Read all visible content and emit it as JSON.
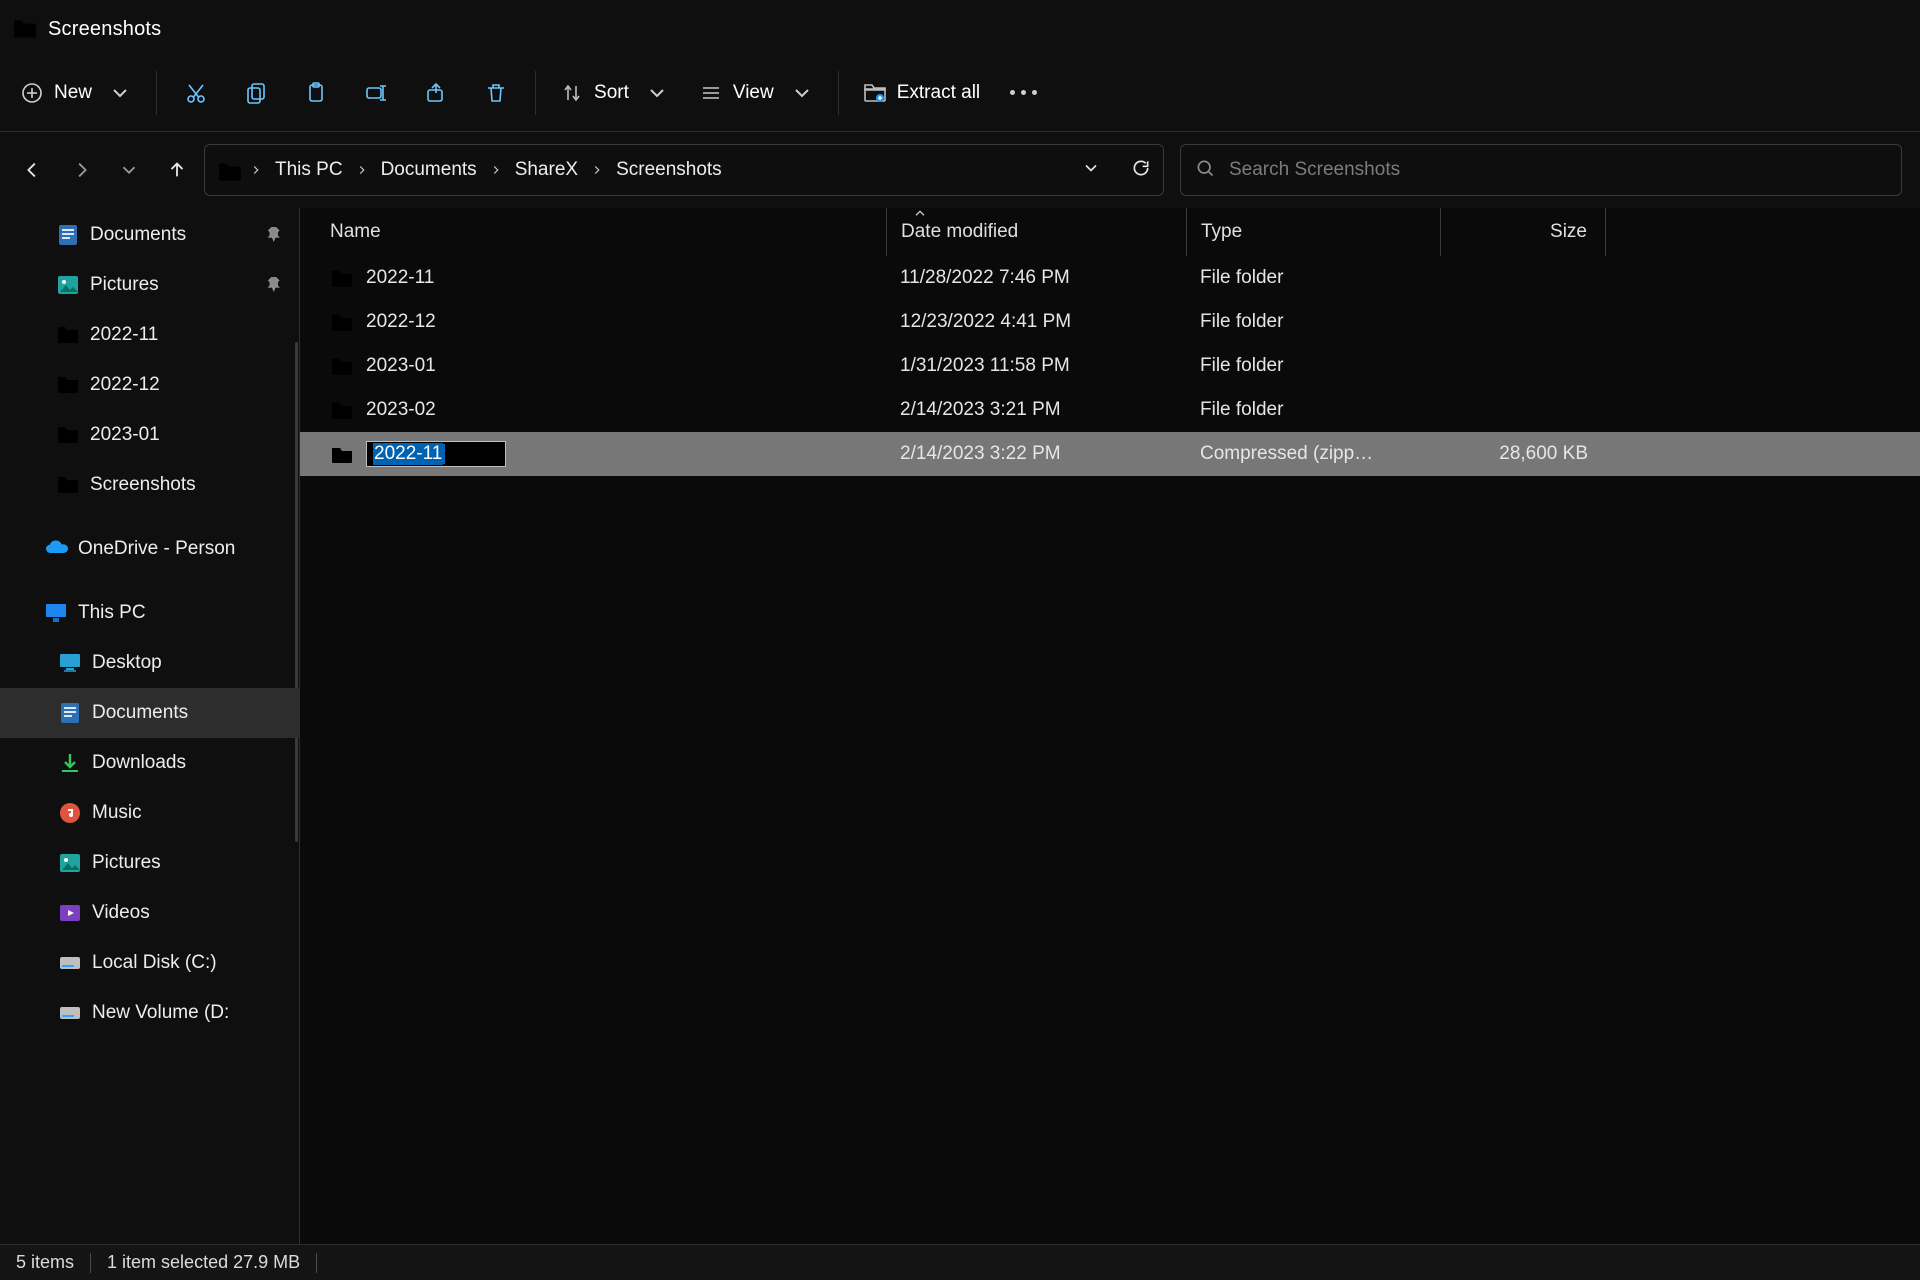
{
  "window": {
    "title": "Screenshots"
  },
  "toolbar": {
    "new_label": "New",
    "sort_label": "Sort",
    "view_label": "View",
    "extract_label": "Extract all"
  },
  "breadcrumbs": {
    "seg1": "This PC",
    "seg2": "Documents",
    "seg3": "ShareX",
    "seg4": "Screenshots"
  },
  "search": {
    "placeholder": "Search Screenshots"
  },
  "sidebar": {
    "documents": "Documents",
    "pictures": "Pictures",
    "q1": "2022-11",
    "q2": "2022-12",
    "q3": "2023-01",
    "q4": "Screenshots",
    "onedrive": "OneDrive - Person",
    "thispc": "This PC",
    "desktop": "Desktop",
    "docs": "Documents",
    "downloads": "Downloads",
    "music": "Music",
    "pics": "Pictures",
    "videos": "Videos",
    "cdrive": "Local Disk (C:)",
    "ddrive": "New Volume (D:"
  },
  "columns": {
    "name": "Name",
    "date": "Date modified",
    "type": "Type",
    "size": "Size"
  },
  "rows": {
    "r0": {
      "name": "2022-11",
      "date": "11/28/2022 7:46 PM",
      "type": "File folder",
      "size": ""
    },
    "r1": {
      "name": "2022-12",
      "date": "12/23/2022 4:41 PM",
      "type": "File folder",
      "size": ""
    },
    "r2": {
      "name": "2023-01",
      "date": "1/31/2023 11:58 PM",
      "type": "File folder",
      "size": ""
    },
    "r3": {
      "name": "2023-02",
      "date": "2/14/2023 3:21 PM",
      "type": "File folder",
      "size": ""
    },
    "r4": {
      "name": "2022-11",
      "date": "2/14/2023 3:22 PM",
      "type": "Compressed (zipp…",
      "size": "28,600 KB"
    }
  },
  "status": {
    "count": "5 items",
    "selection": "1 item selected  27.9 MB"
  }
}
